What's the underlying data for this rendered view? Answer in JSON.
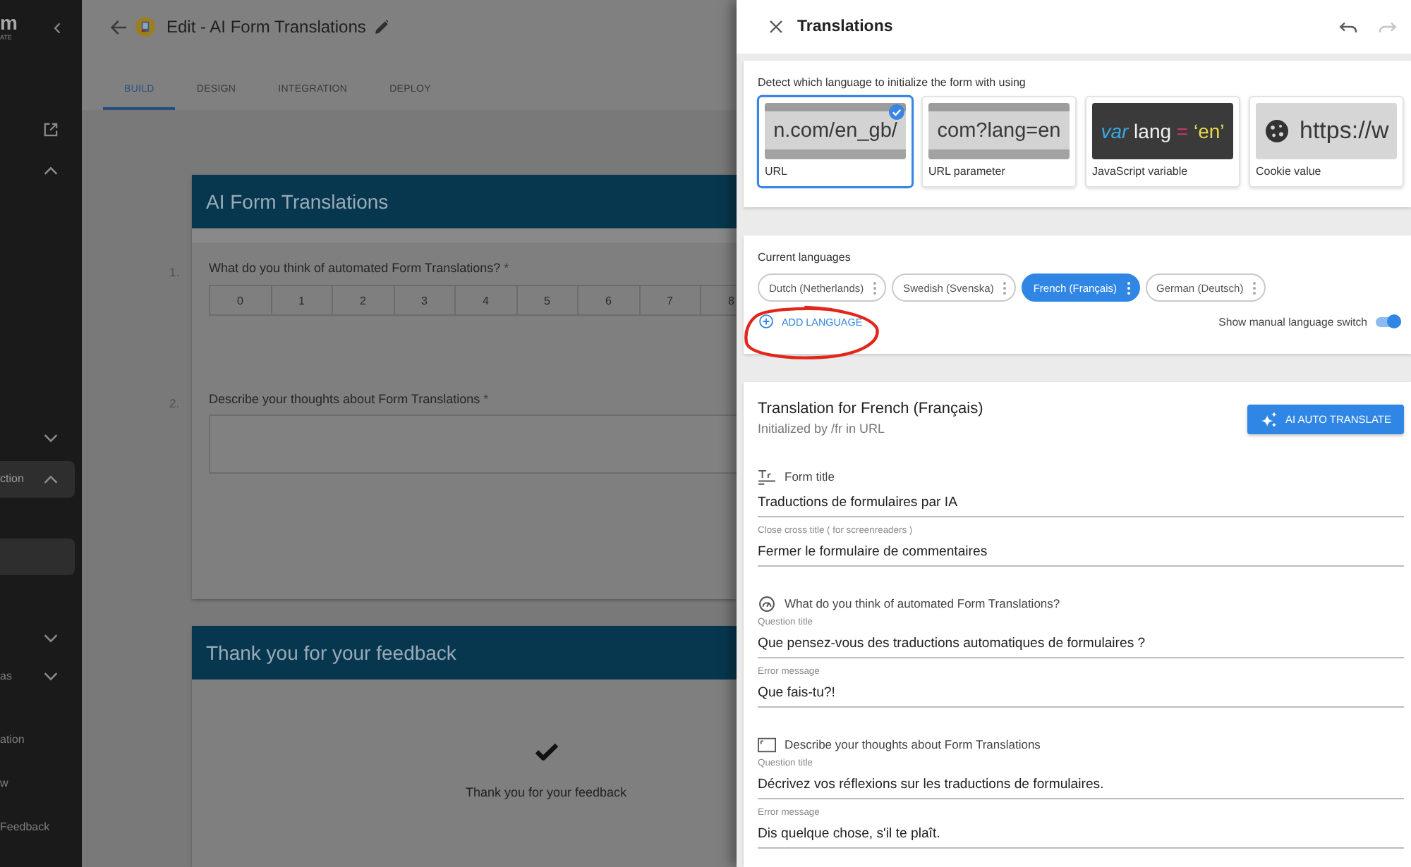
{
  "sidebar": {
    "logo": {
      "letter": "m",
      "tagline": "ATE"
    },
    "items": [
      {
        "kind": "link",
        "selected": false
      },
      {
        "kind": "group",
        "expanded": true,
        "selected": false
      },
      {
        "kind": "group",
        "expanded": false,
        "selected": false
      },
      {
        "kind": "group",
        "label": "ction",
        "expanded": true,
        "selected": true
      },
      {
        "kind": "page",
        "selected": true
      },
      {
        "kind": "group",
        "expanded": false,
        "selected": false
      },
      {
        "kind": "group",
        "label": "as",
        "expanded": false,
        "selected": false
      },
      {
        "kind": "page",
        "label": "ation",
        "selected": false
      },
      {
        "kind": "page",
        "label": "w",
        "selected": false
      },
      {
        "kind": "page",
        "label": "Feedback",
        "selected": false
      }
    ]
  },
  "header": {
    "title": "Edit - AI Form Translations"
  },
  "tabs": [
    {
      "label": "BUILD",
      "selected": true
    },
    {
      "label": "DESIGN",
      "selected": false
    },
    {
      "label": "INTEGRATION",
      "selected": false
    },
    {
      "label": "DEPLOY",
      "selected": false
    }
  ],
  "form_preview": {
    "pages": [
      {
        "kind": "questions",
        "title": "AI Form Translations",
        "questions": [
          {
            "number": "1.",
            "kind": "scale",
            "text": "What do you think of automated Form Translations?",
            "required_mark": "*",
            "scale": [
              "0",
              "1",
              "2",
              "3",
              "4",
              "5",
              "6",
              "7",
              "8"
            ]
          },
          {
            "number": "2.",
            "kind": "textarea",
            "text": "Describe your thoughts about Form Translations",
            "required_mark": "*"
          }
        ]
      },
      {
        "kind": "thank_you",
        "title": "Thank you for your feedback",
        "message": "Thank you for your feedback"
      }
    ]
  },
  "translations_panel": {
    "title": "Translations",
    "history_buttons": [
      {
        "kind": "undo",
        "disabled": false
      },
      {
        "kind": "redo",
        "disabled": true
      }
    ],
    "detection": {
      "label": "Detect which language to initialize the form with using",
      "options": [
        {
          "kind": "address",
          "label": "URL",
          "preview": "n.com/en_gb/",
          "selected": true
        },
        {
          "kind": "address",
          "label": "URL parameter",
          "preview": "com?lang=en",
          "selected": false
        },
        {
          "kind": "code",
          "label": "JavaScript variable",
          "tokens": [
            {
              "kind": "keyword",
              "text": "var"
            },
            {
              "kind": "name",
              "text": "lang"
            },
            {
              "kind": "operator",
              "text": "="
            },
            {
              "kind": "string",
              "text": "‘en’"
            }
          ],
          "selected": false
        },
        {
          "kind": "cookie",
          "label": "Cookie value",
          "preview": "https://w",
          "selected": false
        }
      ]
    },
    "languages": {
      "label": "Current languages",
      "items": [
        {
          "label": "Dutch (Netherlands)",
          "selected": false
        },
        {
          "label": "Swedish (Svenska)",
          "selected": false
        },
        {
          "label": "French (Français)",
          "selected": true
        },
        {
          "label": "German (Deutsch)",
          "selected": false
        }
      ],
      "add_language": {
        "label": "ADD LANGUAGE",
        "circled": true
      },
      "manual_switch": {
        "label": "Show manual language switch",
        "on": true
      }
    },
    "translation": {
      "title": "Translation for French (Français)",
      "subtitle": "Initialized by /fr in URL",
      "ai_button": "AI AUTO TRANSLATE",
      "groups": [
        {
          "kind": "title",
          "label": "Form title",
          "fields": [
            {
              "value": "Traductions de formulaires par IA"
            },
            {
              "label": "Close cross title ( for screenreaders )",
              "value": "Fermer le formulaire de commentaires"
            }
          ]
        },
        {
          "kind": "rating",
          "label": "What do you think of automated Form Translations?",
          "fields": [
            {
              "label": "Question title",
              "value": "Que pensez-vous des traductions automatiques de formulaires ?"
            },
            {
              "label": "Error message",
              "value": "Que fais-tu?!"
            }
          ]
        },
        {
          "kind": "text",
          "label": "Describe your thoughts about Form Translations",
          "fields": [
            {
              "label": "Question title",
              "value": "Décrivez vos réflexions sur les traductions de formulaires."
            },
            {
              "label": "Error message",
              "value": "Dis quelque chose, s'il te plaît."
            }
          ]
        }
      ]
    }
  }
}
